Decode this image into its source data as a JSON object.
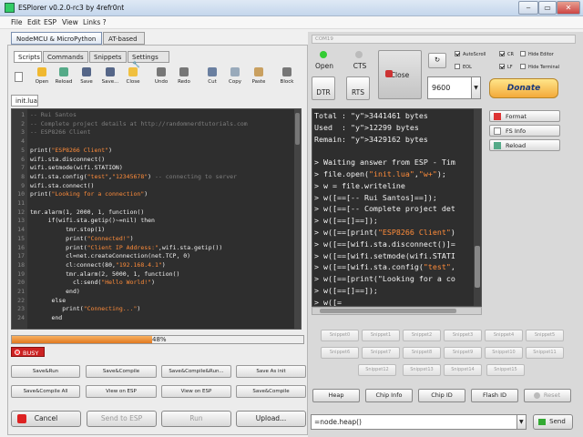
{
  "window": {
    "title": "ESPlorer v0.2.0-rc3 by 4refr0nt"
  },
  "menu": [
    "File",
    "Edit",
    "ESP",
    "View",
    "Links ?"
  ],
  "main_tabs": [
    "NodeMCU & MicroPython",
    "AT-based"
  ],
  "sub_tabs": [
    "Scripts",
    "Commands",
    "Snippets",
    "Settings"
  ],
  "toolbar": [
    "Open",
    "Reload",
    "Save",
    "Save...",
    "Close",
    "Undo",
    "Redo",
    "Cut",
    "Copy",
    "Paste",
    "Block"
  ],
  "file_tab": "init.lua",
  "editor": {
    "lines": [
      "-- Rui Santos",
      "-- Complete project details at http://randomnerdtutorials.com",
      "-- ESP8266 Client",
      "",
      "print(\"ESP8266 Client\")",
      "wifi.sta.disconnect()",
      "wifi.setmode(wifi.STATION)",
      "wifi.sta.config(\"test\",\"12345678\") -- connecting to server",
      "wifi.sta.connect()",
      "print(\"Looking for a connection\")",
      "",
      "tmr.alarm(1, 2000, 1, function()",
      "     if(wifi.sta.getip()~=nil) then",
      "          tmr.stop(1)",
      "          print(\"Connected!\")",
      "          print(\"Client IP Address:\",wifi.sta.getip())",
      "          cl=net.createConnection(net.TCP, 0)",
      "          cl:connect(80,\"192.168.4.1\")",
      "          tmr.alarm(2, 5000, 1, function()",
      "            cl:send(\"Hello World!\")",
      "          end)",
      "      else",
      "         print(\"Connecting...\")",
      "      end"
    ]
  },
  "progress": {
    "label": "48%",
    "value": 48
  },
  "busy": "BUSY",
  "command_buttons": [
    [
      "Save&Run",
      "Save&Compile",
      "Save&Compile&Run...",
      "Save As init"
    ],
    [
      "Save&Compile All",
      "View on ESP",
      "View on ESP",
      "Save&Compile"
    ]
  ],
  "bottom_left": {
    "cancel": "Cancel",
    "send": "Send to ESP",
    "run": "Run",
    "upload": "Upload..."
  },
  "port": {
    "name": "COM19",
    "baud": "9600"
  },
  "serial": {
    "open": "Open",
    "cts": "CTS",
    "dtr": "DTR",
    "rts": "RTS",
    "close": "Close",
    "donate": "Donate"
  },
  "options": {
    "autoscroll": "AutoScroll",
    "eol": "EOL",
    "cr": "CR",
    "lf": "LF",
    "hide_editor": "Hide Editor",
    "hide_terminal": "Hide Terminal"
  },
  "side_buttons": [
    "Format",
    "FS Info",
    "Reload"
  ],
  "terminal": {
    "lines": [
      {
        "a": "Total : ",
        "b": "3441461",
        "c": " bytes"
      },
      {
        "a": "Used  : ",
        "b": "12299",
        "c": " bytes"
      },
      {
        "a": "Remain: ",
        "b": "3429162",
        "c": " bytes"
      },
      {
        "a": "",
        "b": "",
        "c": ""
      },
      {
        "a": "> Waiting answer from ESP - Tim",
        "b": "",
        "c": ""
      },
      {
        "a": "> file.open(\"init.lua\",\"w+\");",
        "b": "",
        "c": ""
      },
      {
        "a": "> w = file.writeline",
        "b": "",
        "c": ""
      },
      {
        "a": "> w([==[-- Rui Santos]==]);",
        "b": "",
        "c": ""
      },
      {
        "a": "> w([==[-- Complete project det",
        "b": "",
        "c": ""
      },
      {
        "a": "> w([==[]==]);",
        "b": "",
        "c": ""
      },
      {
        "a": "> w([==[print(\"ESP8266 Client\")",
        "b": "",
        "c": ""
      },
      {
        "a": "> w([==[wifi.sta.disconnect()]=",
        "b": "",
        "c": ""
      },
      {
        "a": "> w([==[wifi.setmode(wifi.STATI",
        "b": "",
        "c": ""
      },
      {
        "a": "> w([==[wifi.sta.config(\"test\",",
        "b": "",
        "c": ""
      },
      {
        "a": "> w([==[print(\"Looking for a co",
        "b": "",
        "c": ""
      },
      {
        "a": "> w([==[]==]);",
        "b": "",
        "c": ""
      },
      {
        "a": "> w([=",
        "b": "",
        "c": ""
      }
    ]
  },
  "snippets": [
    "Snippet0",
    "Snippet1",
    "Snippet2",
    "Snippet3",
    "Snippet4",
    "Snippet5",
    "Snippet6",
    "Snippet7",
    "Snippet8",
    "Snippet9",
    "Snippet10",
    "Snippet11",
    "Snippet12",
    "Snippet13",
    "Snippet14",
    "Snippet15"
  ],
  "bottom_right": {
    "heap": "Heap",
    "chip_info": "Chip Info",
    "chip_id": "Chip ID",
    "flash_id": "Flash ID",
    "reset": "Reset"
  },
  "send_input": {
    "value": "=node.heap()",
    "button": "Send"
  }
}
